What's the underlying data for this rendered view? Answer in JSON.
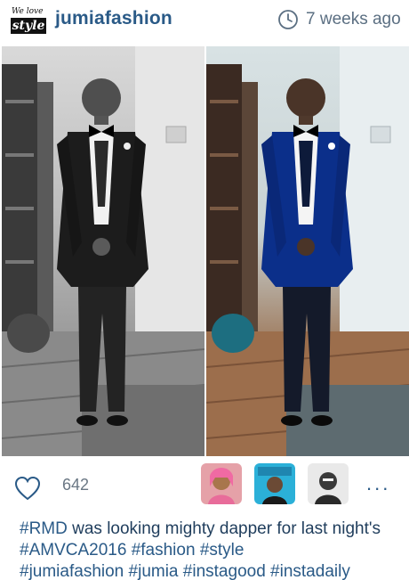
{
  "header": {
    "logo_line1": "We love",
    "logo_line2": "style",
    "username": "jumiafashion",
    "time": "7 weeks ago",
    "clock_icon": "clock-icon"
  },
  "photo": {
    "left_filter": "black-and-white",
    "right_filter": "color"
  },
  "footer": {
    "heart_icon": "heart-icon",
    "like_count": "642",
    "more_icon": "more-dots-icon",
    "more_label": "...",
    "avatars": [
      {
        "name": "avatar-1"
      },
      {
        "name": "avatar-2"
      },
      {
        "name": "avatar-3"
      }
    ],
    "caption": {
      "t1": "#RMD",
      "t2": " was looking mighty dapper for last night's ",
      "t3": "#AMVCA2016",
      "t4": " ",
      "t5": "#fashion",
      "t6": " ",
      "t7": "#style",
      "t8": "#jumiafashion",
      "t9": " ",
      "t10": "#jumia",
      "t11": " ",
      "t12": "#instagood",
      "t13": " ",
      "t14": "#instadaily"
    }
  },
  "colors": {
    "username": "#2a5a87",
    "text": "#1f3d5c",
    "meta": "#5b6f82",
    "suit_blue": "#0b2f8a"
  }
}
